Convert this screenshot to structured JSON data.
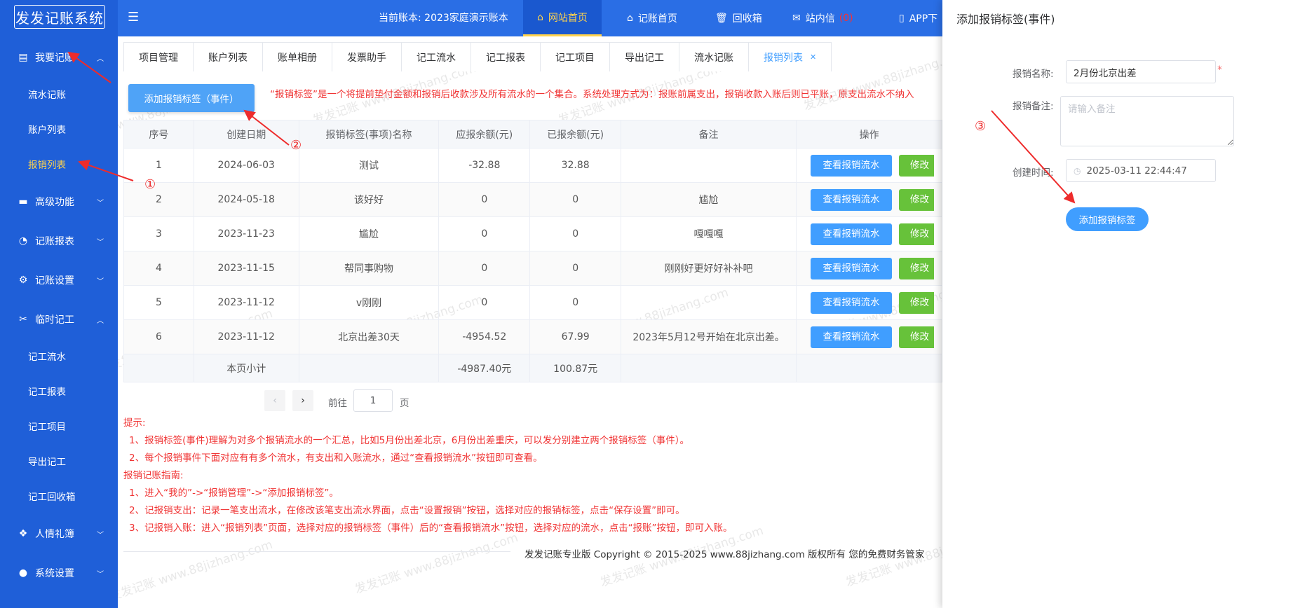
{
  "app": {
    "logo": "发发记账系统"
  },
  "sidebar": {
    "groups": [
      {
        "label": "我要记账",
        "icon": "ledger-icon",
        "expanded": true
      },
      {
        "label": "高级功能",
        "icon": "briefcase-icon"
      },
      {
        "label": "记账报表",
        "icon": "pie-chart-icon"
      },
      {
        "label": "记账设置",
        "icon": "gear-icon"
      },
      {
        "label": "临时记工",
        "icon": "tools-icon",
        "expanded": true
      },
      {
        "label": "人情礼簿",
        "icon": "gift-icon"
      },
      {
        "label": "系统设置",
        "icon": "user-icon"
      }
    ],
    "sub_bookkeeping": [
      "流水记账",
      "账户列表",
      "报销列表"
    ],
    "sub_work": [
      "记工流水",
      "记工报表",
      "记工项目",
      "导出记工",
      "记工回收箱"
    ],
    "active_sub": "报销列表"
  },
  "header": {
    "current_account": "当前账本: 2023家庭演示账本",
    "nav": [
      {
        "label": "网站首页",
        "icon": "home-icon",
        "active": true
      },
      {
        "label": "记账首页",
        "icon": "home-icon"
      },
      {
        "label": "回收箱",
        "icon": "trash-icon"
      },
      {
        "label": "站内信",
        "icon": "mail-icon",
        "badge": "(0)"
      },
      {
        "label": "APP下",
        "icon": "phone-icon"
      }
    ]
  },
  "tabs": [
    "项目管理",
    "账户列表",
    "账单相册",
    "发票助手",
    "记工流水",
    "记工报表",
    "记工项目",
    "导出记工",
    "流水记账",
    "报销列表"
  ],
  "active_tab": "报销列表",
  "toolbar": {
    "add_label": "添加报销标签（事件）",
    "notice": "“报销标签”是一个将提前垫付金额和报销后收款涉及所有流水的一个集合。系统处理方式为：报账前属支出，报销收款入账后则已平账，原支出流水不纳入"
  },
  "table": {
    "headers": [
      "序号",
      "创建日期",
      "报销标签(事项)名称",
      "应报余额(元)",
      "已报余额(元)",
      "备注",
      "操作"
    ],
    "rows": [
      {
        "no": "1",
        "date": "2024-06-03",
        "name": "测试",
        "due": "-32.88",
        "paid": "32.88",
        "remark": ""
      },
      {
        "no": "2",
        "date": "2024-05-18",
        "name": "该好好",
        "due": "0",
        "paid": "0",
        "remark": "尴尬"
      },
      {
        "no": "3",
        "date": "2023-11-23",
        "name": "尴尬",
        "due": "0",
        "paid": "0",
        "remark": "嘎嘎嘎"
      },
      {
        "no": "4",
        "date": "2023-11-15",
        "name": "帮同事购物",
        "due": "0",
        "paid": "0",
        "remark": "刚刚好更好好补补吧"
      },
      {
        "no": "5",
        "date": "2023-11-12",
        "name": "v刚刚",
        "due": "0",
        "paid": "0",
        "remark": ""
      },
      {
        "no": "6",
        "date": "2023-11-12",
        "name": "北京出差30天",
        "due": "-4954.52",
        "paid": "67.99",
        "remark": "2023年5月12号开始在北京出差。"
      }
    ],
    "view_label": "查看报销流水",
    "edit_label": "修改",
    "subtotal": {
      "label": "本页小计",
      "due": "-4987.40元",
      "paid": "100.87元"
    }
  },
  "pagination": {
    "goto_label": "前往",
    "page": "1",
    "page_suffix": "页"
  },
  "tips": {
    "title": "提示:",
    "items": [
      "1、报销标签(事件)理解为对多个报销流水的一个汇总，比如5月份出差北京，6月份出差重庆，可以发分别建立两个报销标签（事件）。",
      "2、每个报销事件下面对应有有多个流水，有支出和入账流水，通过“查看报销流水”按钮即可查看。"
    ],
    "guide_title": "报销记账指南:",
    "guide_items": [
      "1、进入“我的”->“报销管理”->“添加报销标签”。",
      "2、记报销支出：记录一笔支出流水，在修改该笔支出流水界面，点击“设置报销”按钮，选择对应的报销标签，点击“保存设置”即可。",
      "3、记报销入账：进入“报销列表”页面，选择对应的报销标签（事件）后的“查看报销流水”按钮，选择对应的流水，点击“报账”按钮，即可入账。"
    ]
  },
  "footer": "发发记账专业版  Copyright © 2015-2025 www.88jizhang.com 版权所有   您的免费财务管家",
  "panel": {
    "title": "添加报销标签(事件)",
    "name_label": "报销名称:",
    "name_value": "2月份北京出差",
    "remark_label": "报销备注:",
    "remark_placeholder": "请输入备注",
    "time_label": "创建时间:",
    "time_value": "2025-03-11 22:44:47",
    "submit_label": "添加报销标签"
  },
  "annotations": [
    "①",
    "②",
    "③"
  ],
  "watermark": "发发记账 www.88jizhang.com",
  "colors": {
    "sidebar": "#1f5fd8",
    "header": "#2a6ee5",
    "primary": "#409eff",
    "success": "#67c23a",
    "warn_text": "#f03434",
    "active_nav": "#ffd34d"
  }
}
